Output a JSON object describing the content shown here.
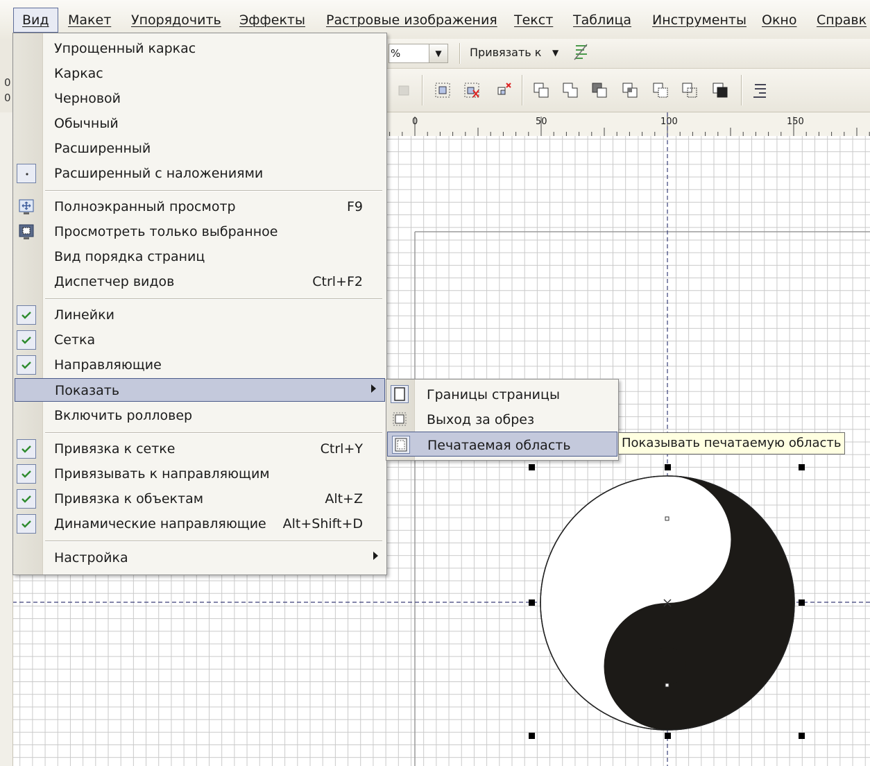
{
  "menubar": {
    "items": [
      {
        "label": "Вид",
        "active": true
      },
      {
        "label": "Макет"
      },
      {
        "label": "Упорядочить"
      },
      {
        "label": "Эффекты"
      },
      {
        "label": "Растровые изображения"
      },
      {
        "label": "Текст"
      },
      {
        "label": "Таблица"
      },
      {
        "label": "Инструменты"
      },
      {
        "label": "Окно"
      },
      {
        "label": "Справк"
      }
    ]
  },
  "toolbar": {
    "zoom_value": "%",
    "snap_label": "Привязать к"
  },
  "left_strip": [
    "0",
    "0"
  ],
  "ruler": {
    "labels": [
      "0",
      "50",
      "100",
      "150"
    ]
  },
  "view_menu": {
    "items": [
      {
        "label": "Упрощенный каркас"
      },
      {
        "label": "Каркас"
      },
      {
        "label": "Черновой"
      },
      {
        "label": "Обычный"
      },
      {
        "label": "Расширенный"
      },
      {
        "label": "Расширенный с наложениями",
        "icon": "dot-box-icon"
      },
      {
        "label": "Полноэкранный просмотр",
        "shortcut": "F9",
        "icon": "fullscreen-icon"
      },
      {
        "label": "Просмотреть только выбранное",
        "icon": "view-selected-icon"
      },
      {
        "label": "Вид порядка страниц"
      },
      {
        "label": "Диспетчер видов",
        "shortcut": "Ctrl+F2"
      },
      {
        "label": "Линейки",
        "checked": true
      },
      {
        "label": "Сетка",
        "checked": true
      },
      {
        "label": "Направляющие",
        "checked": true
      },
      {
        "label": "Показать",
        "submenu": true,
        "highlighted": true
      },
      {
        "label": "Включить ролловер"
      },
      {
        "label": "Привязка к сетке",
        "shortcut": "Ctrl+Y",
        "checked": true
      },
      {
        "label": "Привязывать к направляющим",
        "checked": true
      },
      {
        "label": "Привязка к объектам",
        "shortcut": "Alt+Z",
        "checked": true
      },
      {
        "label": "Динамические направляющие",
        "shortcut": "Alt+Shift+D",
        "checked": true
      },
      {
        "label": "Настройка",
        "submenu": true
      }
    ]
  },
  "show_submenu": {
    "items": [
      {
        "label": "Границы страницы",
        "icon": "page-border-icon",
        "checked": true
      },
      {
        "label": "Выход за обрез",
        "icon": "bleed-icon"
      },
      {
        "label": "Печатаемая область",
        "icon": "printable-area-icon",
        "highlighted": true
      }
    ]
  },
  "tooltip": {
    "text": "Показывать печатаемую область"
  },
  "colors": {
    "menu_highlight": "#c4c9dc",
    "menu_highlight_border": "#4a5a8a",
    "check_green": "#2e8b2e",
    "tooltip_bg": "#ffffe1"
  }
}
